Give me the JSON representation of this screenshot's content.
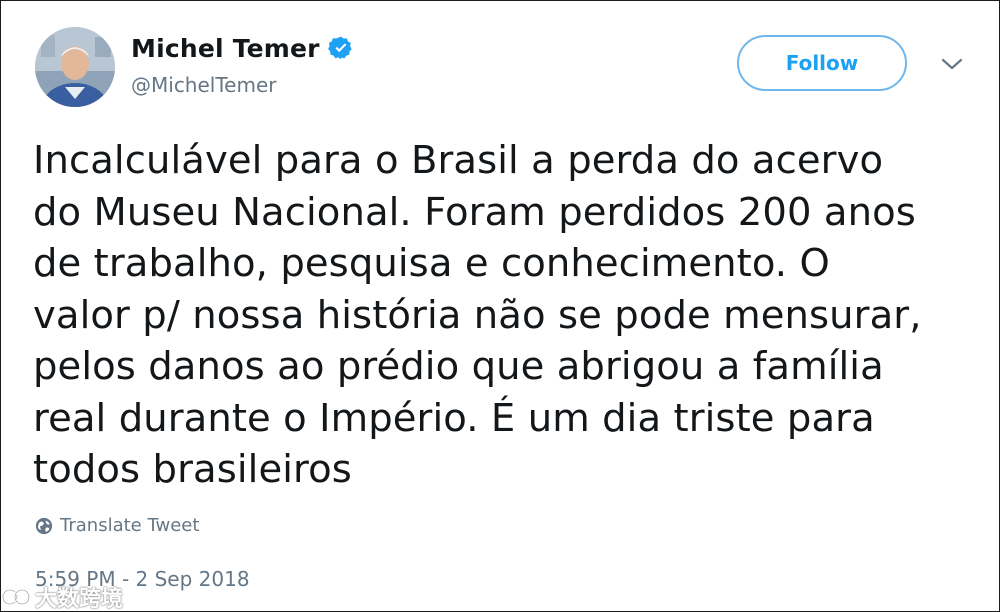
{
  "tweet": {
    "author": {
      "display_name": "Michel Temer",
      "handle": "@MichelTemer",
      "verified": true,
      "avatar_icon": "profile-photo"
    },
    "follow_label": "Follow",
    "menu_icon": "chevron-down-icon",
    "text": "Incalculável para o Brasil a perda do acervo\ndo Museu Nacional. Foram perdidos 200 anos\nde trabalho, pesquisa e conhecimento. O\nvalor p/ nossa história não se pode mensurar,\npelos danos ao prédio que abrigou a família\nreal durante o Império. É um dia triste para\ntodos brasileiros",
    "translate_label": "Translate Tweet",
    "timestamp": "5:59 PM - 2 Sep 2018"
  },
  "watermark": {
    "text": "大数跨境"
  },
  "colors": {
    "accent": "#1da1f2",
    "secondary_text": "#657786",
    "primary_text": "#14171a"
  }
}
